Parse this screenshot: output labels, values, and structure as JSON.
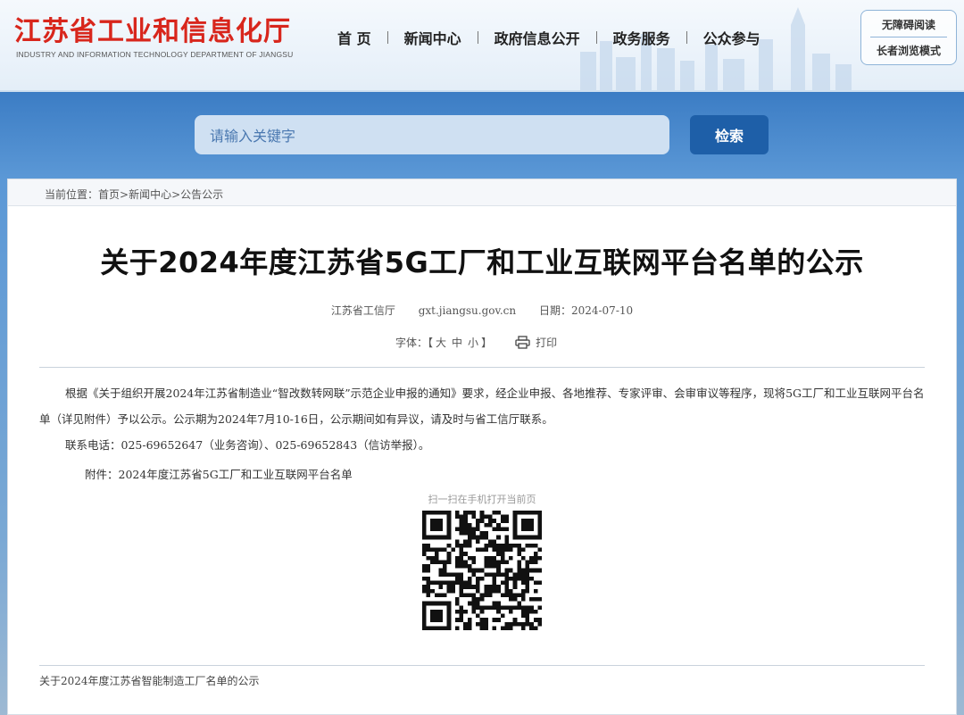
{
  "header": {
    "logo_title": "江苏省工业和信息化厅",
    "logo_subtitle": "INDUSTRY AND INFORMATION TECHNOLOGY DEPARTMENT OF JIANGSU",
    "nav": [
      {
        "label": "首 页"
      },
      {
        "label": "新闻中心"
      },
      {
        "label": "政府信息公开"
      },
      {
        "label": "政务服务"
      },
      {
        "label": "公众参与"
      }
    ],
    "accessibility": {
      "barrier_free": "无障碍阅读",
      "elder_mode": "长者浏览模式"
    }
  },
  "search": {
    "placeholder": "请输入关键字",
    "button": "检索"
  },
  "breadcrumb": {
    "prefix": "当前位置：",
    "items": [
      "首页",
      "新闻中心",
      "公告公示"
    ],
    "separator": ">"
  },
  "article": {
    "title": "关于2024年度江苏省5G工厂和工业互联网平台名单的公示",
    "source": "江苏省工信厅",
    "site": "gxt.jiangsu.gov.cn",
    "date": "日期：2024-07-10",
    "font_label": "字体：【",
    "font_sizes": [
      "大",
      "中",
      "小"
    ],
    "font_close": "】",
    "print_label": "打印",
    "paragraph1": "根据《关于组织开展2024年江苏省制造业“智改数转网联”示范企业申报的通知》要求，经企业申报、各地推荐、专家评审、会审审议等程序，现将5G工厂和工业互联网平台名单（详见附件）予以公示。公示期为2024年7月10-16日，公示期间如有异议，请及时与省工信厅联系。",
    "paragraph2": "联系电话：025-69652647（业务咨询）、025-69652843（信访举报）。",
    "attachment": "附件：2024年度江苏省5G工厂和工业互联网平台名单",
    "qr_caption": "扫一扫在手机打开当前页",
    "related_link": "关于2024年度江苏省智能制造工厂名单的公示"
  },
  "colors": {
    "brand_red": "#d8261c",
    "search_button": "#1e5fa8",
    "search_field": "#cfe0f2"
  },
  "icons": [
    "printer-icon",
    "qr-code"
  ]
}
